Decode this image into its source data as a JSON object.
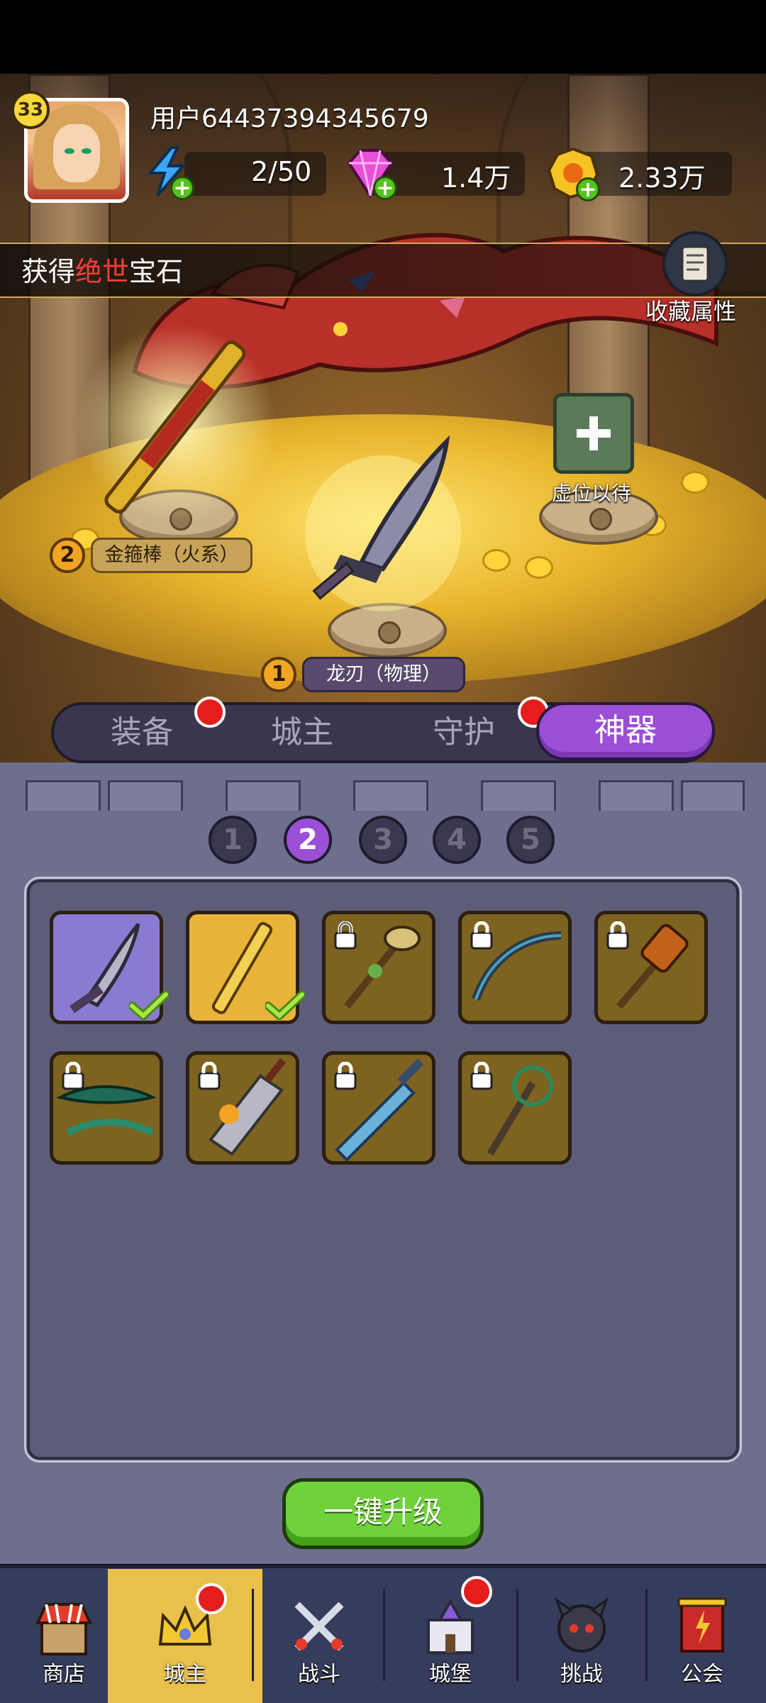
{
  "player": {
    "level": "33",
    "username": "用户64437394345679"
  },
  "resources": {
    "energy": "2/50",
    "gems": "1.4万",
    "gold": "2.33万"
  },
  "banner": {
    "prefix": "获得",
    "highlight": "绝世",
    "suffix": "宝石"
  },
  "collection": {
    "label": "收藏属性"
  },
  "slots": [
    {
      "number": "2",
      "label": "金箍棒（火系）"
    },
    {
      "number": "1",
      "label": "龙刃（物理）"
    },
    {
      "empty_label": "虚位以待"
    }
  ],
  "tabs": [
    {
      "label": "装备",
      "badge": true
    },
    {
      "label": "城主",
      "badge": false
    },
    {
      "label": "守护",
      "badge": true
    },
    {
      "label": "神器",
      "badge": false,
      "active": true
    }
  ],
  "sub_tabs": [
    "1",
    "2",
    "3",
    "4",
    "5"
  ],
  "active_sub_tab": "2",
  "artifacts": [
    {
      "name": "dragon-blade",
      "state": "equipped"
    },
    {
      "name": "golden-staff",
      "state": "equipped"
    },
    {
      "name": "leaf-staff",
      "state": "locked"
    },
    {
      "name": "dark-bow",
      "state": "locked"
    },
    {
      "name": "spiked-mace",
      "state": "locked"
    },
    {
      "name": "jade-glaive",
      "state": "locked"
    },
    {
      "name": "flame-cleaver",
      "state": "locked"
    },
    {
      "name": "frost-sword",
      "state": "locked"
    },
    {
      "name": "vine-scepter",
      "state": "locked"
    }
  ],
  "upgrade_button": {
    "label": "一键升级"
  },
  "nav": [
    {
      "label": "商店",
      "icon": "shop-icon"
    },
    {
      "label": "城主",
      "icon": "crown-icon",
      "active": true,
      "badge": true
    },
    {
      "label": "战斗",
      "icon": "crossed-swords-icon"
    },
    {
      "label": "城堡",
      "icon": "castle-icon",
      "badge": true
    },
    {
      "label": "挑战",
      "icon": "demon-icon"
    },
    {
      "label": "公会",
      "icon": "guild-banner-icon"
    }
  ],
  "colors": {
    "accent": "#9a4fd6",
    "badge": "#e51d1d",
    "upgrade": "#6fd23a",
    "banner_highlight": "#ff3b3b"
  }
}
